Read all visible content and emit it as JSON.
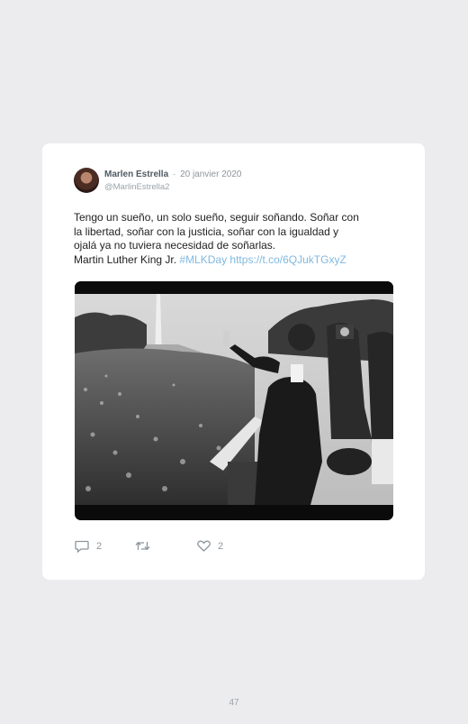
{
  "tweet": {
    "author_name": "Marlen Estrella",
    "separator": "·",
    "date": "20 janvier 2020",
    "handle": "@MarlinEstrella2",
    "text_lines": [
      "Tengo un sueño, un solo sueño, seguir soñando. Soñar con",
      "la libertad, soñar con la justicia, soñar con la igualdad y",
      "ojalá ya no tuviera necesidad de soñarlas."
    ],
    "attribution": "Martin Luther King Jr. ",
    "hashtag": "#MLKDay",
    "link": "https://t.co/6QJukTGxyZ",
    "reply_count": "2",
    "retweet_count": "",
    "like_count": "2"
  },
  "icons": {
    "avatar": "author-avatar",
    "reply": "reply-icon",
    "retweet": "retweet-icon",
    "like": "heart-icon"
  },
  "page_number": "47"
}
